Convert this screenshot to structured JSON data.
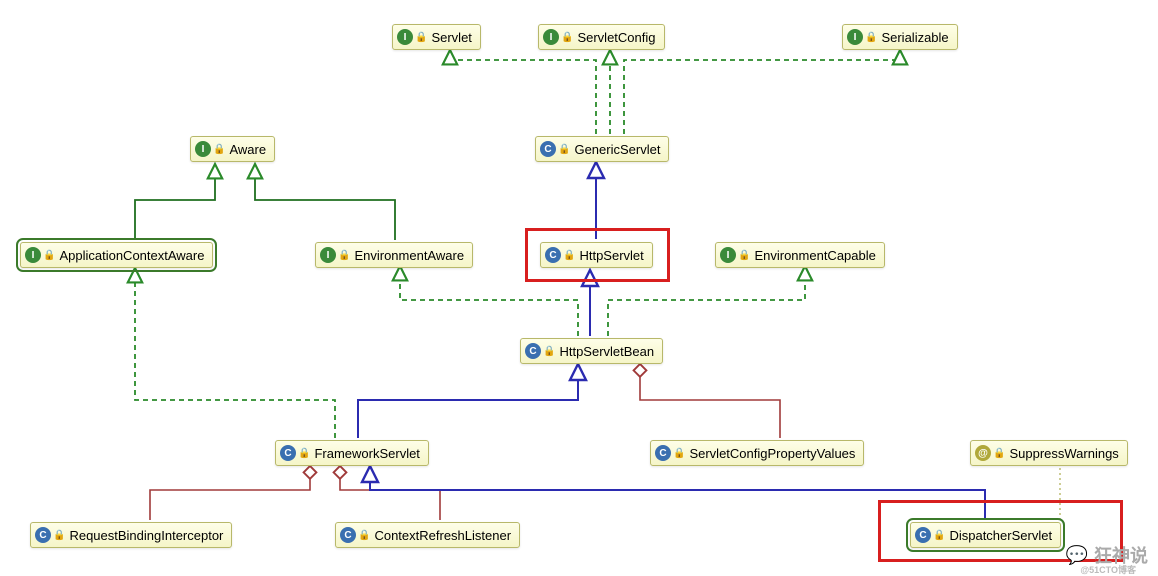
{
  "nodes": {
    "servlet": {
      "label": "Servlet",
      "icon": "I"
    },
    "servletConfig": {
      "label": "ServletConfig",
      "icon": "I"
    },
    "serializable": {
      "label": "Serializable",
      "icon": "I"
    },
    "aware": {
      "label": "Aware",
      "icon": "I"
    },
    "genericServlet": {
      "label": "GenericServlet",
      "icon": "C"
    },
    "appCtxAware": {
      "label": "ApplicationContextAware",
      "icon": "I"
    },
    "envAware": {
      "label": "EnvironmentAware",
      "icon": "I"
    },
    "httpServlet": {
      "label": "HttpServlet",
      "icon": "C"
    },
    "envCapable": {
      "label": "EnvironmentCapable",
      "icon": "I"
    },
    "httpServletBean": {
      "label": "HttpServletBean",
      "icon": "C"
    },
    "frameworkServlet": {
      "label": "FrameworkServlet",
      "icon": "C"
    },
    "servletConfigPV": {
      "label": "ServletConfigPropertyValues",
      "icon": "C",
      "lock": true
    },
    "suppressWarnings": {
      "label": "SuppressWarnings",
      "icon": "A"
    },
    "reqBindingInterceptor": {
      "label": "RequestBindingInterceptor",
      "icon": "C",
      "lock": true
    },
    "ctxRefreshListener": {
      "label": "ContextRefreshListener",
      "icon": "C",
      "lock": true
    },
    "dispatcherServlet": {
      "label": "DispatcherServlet",
      "icon": "C"
    }
  },
  "watermark": {
    "text": "狂神说",
    "sub": "@51CTO博客"
  }
}
